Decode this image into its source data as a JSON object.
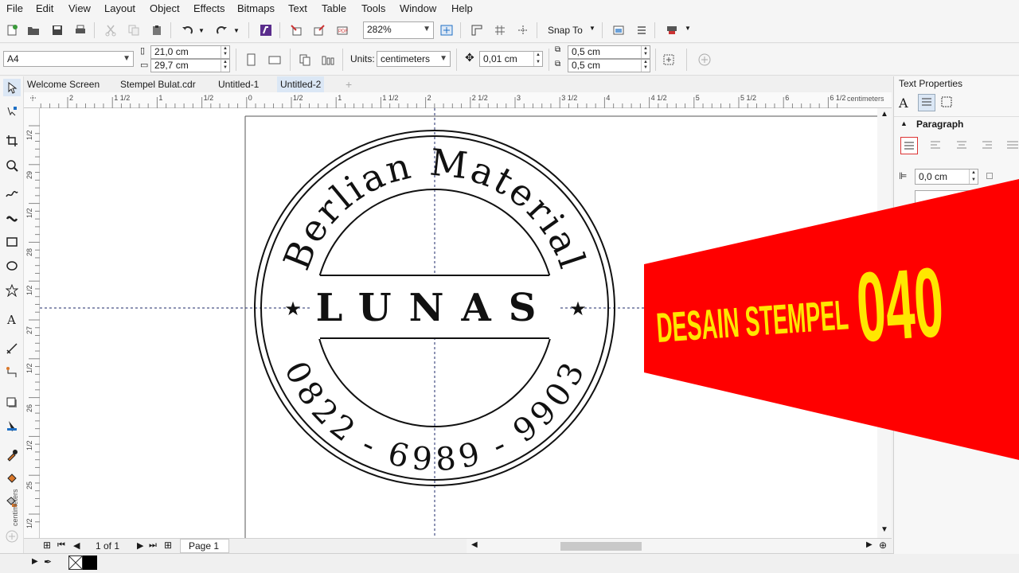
{
  "menu": [
    "File",
    "Edit",
    "View",
    "Layout",
    "Object",
    "Effects",
    "Bitmaps",
    "Text",
    "Table",
    "Tools",
    "Window",
    "Help"
  ],
  "toolbar": {
    "zoom": "282%",
    "snap_to": "Snap To"
  },
  "property_bar": {
    "page_size": "A4",
    "width": "21,0 cm",
    "height": "29,7 cm",
    "units_label": "Units:",
    "units_value": "centimeters",
    "nudge": "0,01 cm",
    "dup_x": "0,5 cm",
    "dup_y": "0,5 cm"
  },
  "tabs": [
    "Welcome Screen",
    "Stempel Bulat.cdr",
    "Untitled-1",
    "Untitled-2"
  ],
  "active_tab": "Untitled-2",
  "ruler": {
    "h_labels": [
      "2",
      "1 1/2",
      "1",
      "1/2",
      "0",
      "1/2",
      "1",
      "1 1/2",
      "2",
      "2 1/2",
      "3",
      "3 1/2",
      "4",
      "4 1/2",
      "5",
      "5 1/2",
      "6",
      "6 1/2"
    ],
    "unit": "centimeters",
    "v_labels": [
      "1/2",
      "29",
      "1/2",
      "28",
      "1/2",
      "27",
      "1/2",
      "26",
      "1/2",
      "25",
      "1/2"
    ],
    "v_unit": "centimeters"
  },
  "stamp": {
    "top_text": "Berlian Material",
    "center_text": "LUNAS",
    "bottom_text": "0822 - 6989 - 9903",
    "star": "★"
  },
  "banner": {
    "text": "DESAIN STEMPEL 040",
    "bg_color": "#ff0000",
    "text_color": "#ffe600"
  },
  "page_nav": {
    "counter": "1 of 1",
    "page_tab": "Page 1"
  },
  "docker": {
    "title": "Text Properties",
    "section": "Paragraph",
    "indent_value": "0,0 cm"
  },
  "colors": {
    "accent": "#1e6fc5",
    "guide": "#1e2a6a"
  }
}
